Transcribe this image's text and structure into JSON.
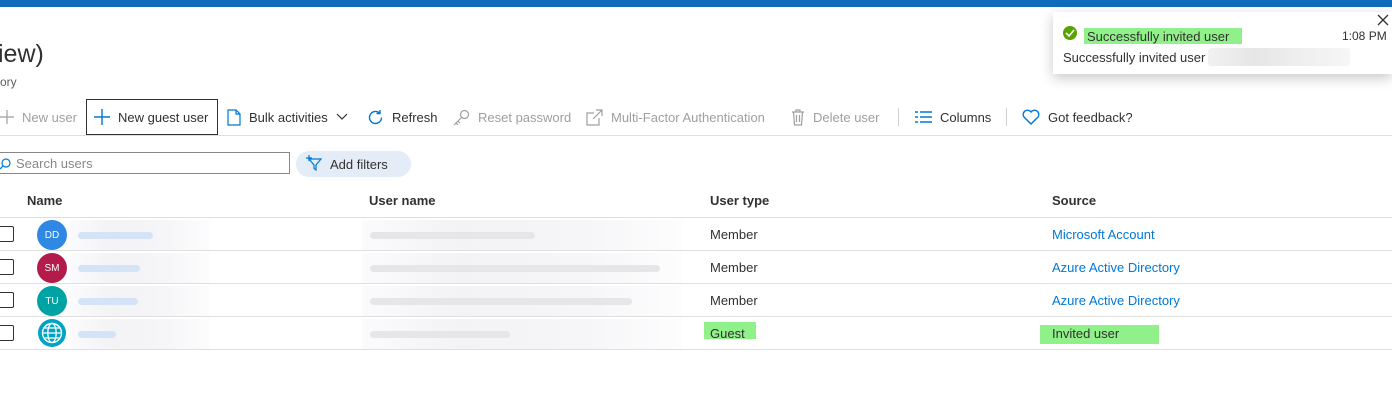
{
  "page": {
    "title": "iew)",
    "subtitle": "ory"
  },
  "toolbar": {
    "new_user": "New user",
    "new_guest_user": "New guest user",
    "bulk_activities": "Bulk activities",
    "refresh": "Refresh",
    "reset_password": "Reset password",
    "mfa": "Multi-Factor Authentication",
    "delete_user": "Delete user",
    "columns": "Columns",
    "feedback": "Got feedback?"
  },
  "search": {
    "placeholder": "Search users",
    "add_filters": "Add filters"
  },
  "table": {
    "headers": {
      "name": "Name",
      "user_name": "User name",
      "user_type": "User type",
      "source": "Source"
    },
    "rows": [
      {
        "initials": "DD",
        "avatar_color": "#2f88e4",
        "user_type": "Member",
        "source": "Microsoft Account"
      },
      {
        "initials": "SM",
        "avatar_color": "#b21b4a",
        "user_type": "Member",
        "source": "Azure Active Directory"
      },
      {
        "initials": "TU",
        "avatar_color": "#00a3a3",
        "user_type": "Member",
        "source": "Azure Active Directory"
      },
      {
        "initials": "",
        "avatar_icon": "globe-icon",
        "user_type": "Guest",
        "source": "Invited user"
      }
    ]
  },
  "notification": {
    "title": "Successfully invited user",
    "time": "1:08 PM",
    "message": "Successfully invited user"
  },
  "colors": {
    "accent": "#0f6cbd",
    "link": "#0078d4",
    "success": "#57a300",
    "highlight": "#90f08a"
  }
}
